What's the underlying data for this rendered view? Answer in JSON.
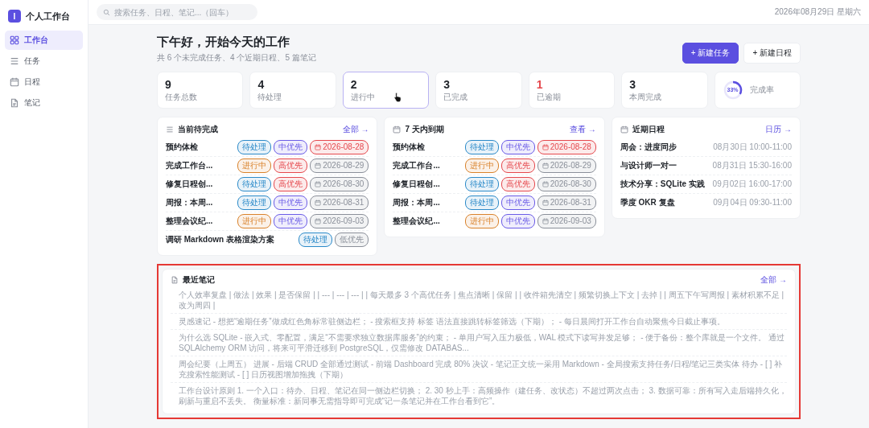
{
  "sidebar": {
    "brand": {
      "logo": "I",
      "name": "个人工作台"
    },
    "items": [
      {
        "label": "工作台",
        "selected": true
      },
      {
        "label": "任务",
        "selected": false
      },
      {
        "label": "日程",
        "selected": false
      },
      {
        "label": "笔记",
        "selected": false
      }
    ]
  },
  "topbar": {
    "search": {
      "placeholder": "搜索任务、日程、笔记...（回车）"
    },
    "date": "2026年08月29日 星期六"
  },
  "header": {
    "title": "下午好，开始今天的工作",
    "subtitle": "共 6 个未完成任务、4 个近期日程、5 篇笔记",
    "buttons": [
      {
        "label": "+ 新建任务",
        "kind": "primary"
      },
      {
        "label": "+ 新建日程",
        "kind": "secondary"
      }
    ]
  },
  "stats": [
    {
      "kind": "count",
      "value": "9",
      "label": "任务总数",
      "color": "#1f2329",
      "selected": false
    },
    {
      "kind": "count",
      "value": "4",
      "label": "待处理",
      "color": "#1f2329",
      "selected": false
    },
    {
      "kind": "count",
      "value": "2",
      "label": "进行中",
      "color": "#1f2329",
      "selected": true
    },
    {
      "kind": "count",
      "value": "3",
      "label": "已完成",
      "color": "#1f2329",
      "selected": false
    },
    {
      "kind": "count",
      "value": "1",
      "label": "已逾期",
      "color": "#e5484d",
      "selected": false
    },
    {
      "kind": "count",
      "value": "3",
      "label": "本周完成",
      "color": "#1f2329",
      "selected": false
    },
    {
      "kind": "ring",
      "value": "33%",
      "label": "完成率",
      "level": 0.33,
      "selected": false
    }
  ],
  "panels": [
    {
      "kind": "tasks",
      "title": "当前待完成",
      "link": "全部 →",
      "rows": [
        {
          "name": "预约体检",
          "status": {
            "label": "待处理",
            "color": "#2b8ac9"
          },
          "priority": {
            "label": "中优先",
            "color": "#6a5be6"
          },
          "due": {
            "label": "2026-08-28",
            "color": "#e5484d"
          }
        },
        {
          "name": "完成工作台...",
          "status": {
            "label": "进行中",
            "color": "#d9822b"
          },
          "priority": {
            "label": "高优先",
            "color": "#e5484d"
          },
          "due": {
            "label": "2026-08-29",
            "color": "#8a8f99"
          }
        },
        {
          "name": "修复日程创...",
          "status": {
            "label": "待处理",
            "color": "#2b8ac9"
          },
          "priority": {
            "label": "高优先",
            "color": "#e5484d"
          },
          "due": {
            "label": "2026-08-30",
            "color": "#8a8f99"
          }
        },
        {
          "name": "周报：本周...",
          "status": {
            "label": "待处理",
            "color": "#2b8ac9"
          },
          "priority": {
            "label": "中优先",
            "color": "#6a5be6"
          },
          "due": {
            "label": "2026-08-31",
            "color": "#8a8f99"
          }
        },
        {
          "name": "整理会议纪...",
          "status": {
            "label": "进行中",
            "color": "#d9822b"
          },
          "priority": {
            "label": "中优先",
            "color": "#6a5be6"
          },
          "due": {
            "label": "2026-09-03",
            "color": "#8a8f99"
          }
        },
        {
          "name": "调研 Markdown 表格渲染方案",
          "status": {
            "label": "待处理",
            "color": "#2b8ac9"
          },
          "priority": {
            "label": "低优先",
            "color": "#8a8f99"
          }
        }
      ]
    },
    {
      "kind": "tasks",
      "title": "7 天内到期",
      "link": "查看 →",
      "rows": [
        {
          "name": "预约体检",
          "status": {
            "label": "待处理",
            "color": "#2b8ac9"
          },
          "priority": {
            "label": "中优先",
            "color": "#6a5be6"
          },
          "due": {
            "label": "2026-08-28",
            "color": "#e5484d"
          }
        },
        {
          "name": "完成工作台...",
          "status": {
            "label": "进行中",
            "color": "#d9822b"
          },
          "priority": {
            "label": "高优先",
            "color": "#e5484d"
          },
          "due": {
            "label": "2026-08-29",
            "color": "#8a8f99"
          }
        },
        {
          "name": "修复日程创...",
          "status": {
            "label": "待处理",
            "color": "#2b8ac9"
          },
          "priority": {
            "label": "高优先",
            "color": "#e5484d"
          },
          "due": {
            "label": "2026-08-30",
            "color": "#8a8f99"
          }
        },
        {
          "name": "周报：本周...",
          "status": {
            "label": "待处理",
            "color": "#2b8ac9"
          },
          "priority": {
            "label": "中优先",
            "color": "#6a5be6"
          },
          "due": {
            "label": "2026-08-31",
            "color": "#8a8f99"
          }
        },
        {
          "name": "整理会议纪...",
          "status": {
            "label": "进行中",
            "color": "#d9822b"
          },
          "priority": {
            "label": "中优先",
            "color": "#6a5be6"
          },
          "due": {
            "label": "2026-09-03",
            "color": "#8a8f99"
          }
        }
      ]
    },
    {
      "kind": "events",
      "title": "近期日程",
      "link": "日历 →",
      "rows": [
        {
          "title": "周会：进度同步",
          "time": "08月30日 10:00-11:00"
        },
        {
          "title": "与设计师一对一",
          "time": "08月31日 15:30-16:00"
        },
        {
          "title": "技术分享：SQLite 实践",
          "time": "09月02日 16:00-17:00"
        },
        {
          "title": "季度 OKR 复盘",
          "time": "09月04日 09:30-11:00"
        }
      ]
    }
  ],
  "notes": {
    "title": "最近笔记",
    "link": "全部 →",
    "highlighted": true,
    "rows": [
      "个人效率复盘 | 做法 | 效果 | 是否保留 | | --- | --- | --- | | 每天最多 3 个高优任务 | 焦点清晰 | 保留 | | 收件箱先清空 | 频繁切换上下文 | 去掉 | | 周五下午写周报 | 素材积累不足 | 改为周四 |",
      "灵感速记 - 想把“逾期任务”做成红色角标常驻侧边栏； - 搜索框支持 标签 语法直接跳转标签筛选（下期）； - 每日晨间打开工作台自动聚焦今日截止事项。",
      "为什么选 SQLite - 嵌入式、零配置，满足“不需要求独立数据库服务”的约束； - 单用户写入压力极低，WAL 模式下读写并发足够； - 便于备份：整个库就是一个文件。 通过 SQLAlchemy ORM 访问，将来可平滑迁移到 PostgreSQL，仅需修改 DATABAS...",
      "周会纪要（上周五） 进展 - 后端 CRUD 全部通过测试 - 前端 Dashboard 完成 80% 决议 - 笔记正文统一采用 Markdown - 全局搜索支持任务/日程/笔记三类实体 待办 - [ ] 补充搜索性能测试 - [ ] 日历视图增加拖拽（下期）",
      "工作台设计原则 1. 一个入口：待办、日程、笔记在同一侧边栏切换； 2. 30 秒上手：高频操作（建任务、改状态）不超过两次点击； 3. 数据可靠：所有写入走后端持久化，刷新与重启不丢失。 衡量标准：新同事无需指导即可完成“记一条笔记并在工作台看到它”。"
    ]
  }
}
